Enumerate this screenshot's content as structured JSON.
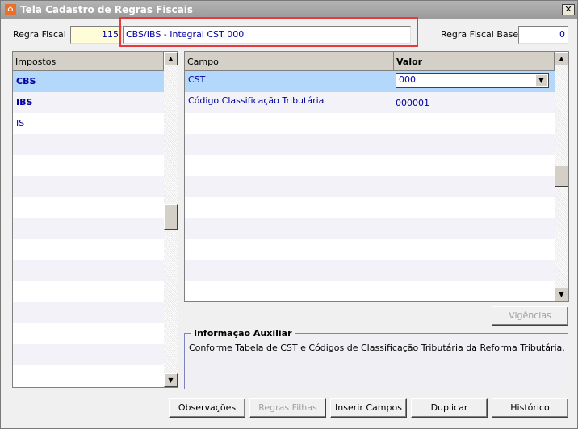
{
  "window": {
    "title": "Tela Cadastro de Regras Fiscais",
    "close": "✕"
  },
  "header": {
    "regra_fiscal_label": "Regra Fiscal",
    "regra_fiscal_value": "115",
    "descricao_value": "CBS/IBS - Integral CST 000",
    "regra_base_label": "Regra Fiscal Base",
    "regra_base_value": "0"
  },
  "impostos": {
    "header": "Impostos",
    "items": [
      {
        "label": "CBS",
        "bold": true,
        "selected": true
      },
      {
        "label": "IBS",
        "bold": true
      },
      {
        "label": "IS"
      }
    ]
  },
  "campos": {
    "headers": {
      "campo": "Campo",
      "valor": "Valor"
    },
    "rows": [
      {
        "campo": "CST",
        "valor": "000",
        "type": "select"
      },
      {
        "campo": "Código Classificação Tributária",
        "valor": "000001"
      }
    ]
  },
  "vigencias_label": "Vigências",
  "info": {
    "title": "Informação Auxiliar",
    "text": "Conforme Tabela de CST e Códigos de Classificação Tributária da Reforma Tributária."
  },
  "buttons": {
    "observacoes": "Observações",
    "regras_filhas": "Regras Filhas",
    "inserir_campos": "Inserir Campos",
    "duplicar": "Duplicar",
    "historico": "Histórico"
  },
  "colors": {
    "selected_row": "#b4d8fc",
    "highlight_border": "#e8383d",
    "text_blue": "#0000a0"
  }
}
